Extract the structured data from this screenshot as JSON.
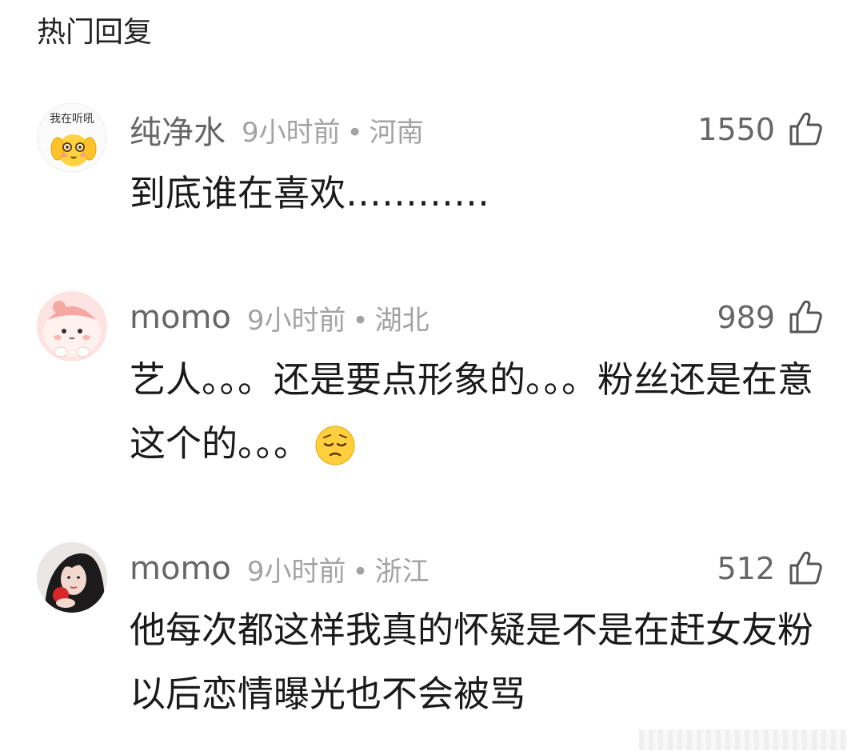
{
  "section": {
    "title": "热门回复"
  },
  "comments": [
    {
      "username": "纯净水",
      "time": "9小时前",
      "separator": "•",
      "location": "河南",
      "likes": "1550",
      "text": "到底谁在喜欢…………",
      "avatar_label": "我在听吼"
    },
    {
      "username": "momo",
      "time": "9小时前",
      "separator": "•",
      "location": "湖北",
      "likes": "989",
      "text": "艺人。。。还是要点形象的。。。粉丝还是在意这个的。。。",
      "emoji": "pensive-face"
    },
    {
      "username": "momo",
      "time": "9小时前",
      "separator": "•",
      "location": "浙江",
      "likes": "512",
      "text": "他每次都这样我真的怀疑是不是在赶女友粉以后恋情曝光也不会被骂"
    }
  ]
}
